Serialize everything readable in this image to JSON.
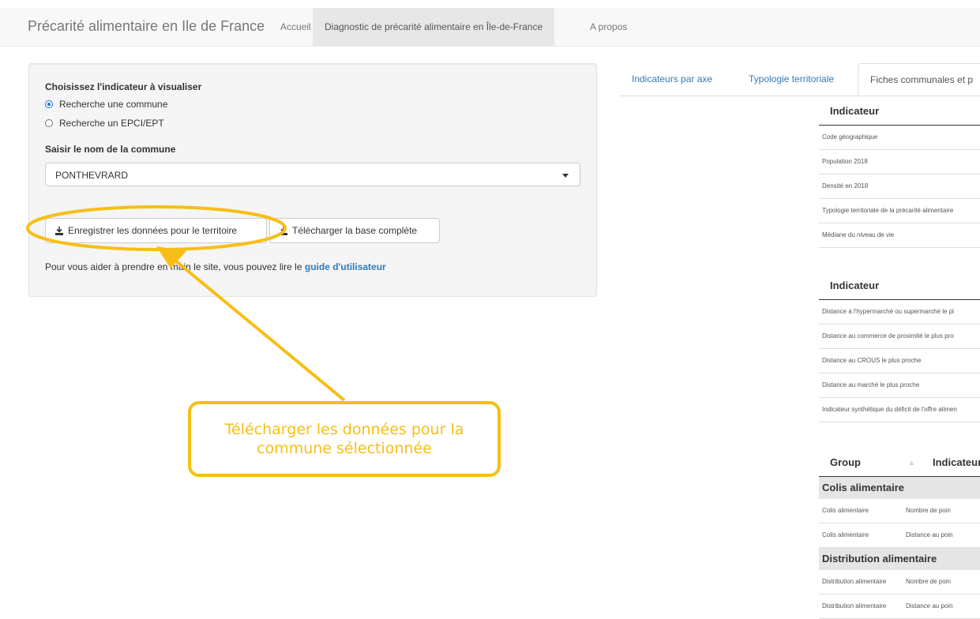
{
  "navbar": {
    "brand": "Précarité alimentaire en Ile de France",
    "items": [
      "Accueil",
      "Diagnostic de précarité alimentaire en Île-de-France",
      "A propos"
    ]
  },
  "sidebar": {
    "indicator_label": "Choisissez l'indicateur à visualiser",
    "radio_commune": "Recherche une commune",
    "radio_epci": "Recherche un EPCI/EPT",
    "commune_label": "Saisir le nom de la commune",
    "commune_value": "PONTHEVRARD",
    "btn_save": "Enregistrer les données pour le territoire",
    "btn_download": "Télécharger la base complète",
    "help_text": "Pour vous aider à prendre en main le site, vous pouvez lire le ",
    "help_link": "guide d'utilisateur"
  },
  "tabs": [
    "Indicateurs par axe",
    "Typologie territoriale",
    "Fiches communales et p"
  ],
  "table1": {
    "header": "Indicateur",
    "rows": [
      "Code géographique",
      "Population 2018",
      "Densité en 2018",
      "Typologie territoriale de la précarité alimentaire",
      "Médiane du niveau de vie"
    ]
  },
  "table2": {
    "header": "Indicateur",
    "rows": [
      "Distance à l'hypermarché ou supermarché le pl",
      "Distance au commerce de proximité le plus pro",
      "Distance au CROUS le plus proche",
      "Distance au marché le plus proche",
      "Indicateur synthétique du déficit de l'offre alimen"
    ]
  },
  "table3": {
    "header_group": "Group",
    "header_ind": "Indicateur",
    "groups": [
      {
        "name": "Colis alimentaire",
        "rows": [
          [
            "Colis alimentaire",
            "Nombre de poin"
          ],
          [
            "Colis alimentaire",
            "Distance au poin"
          ]
        ]
      },
      {
        "name": "Distribution alimentaire",
        "rows": [
          [
            "Distribution alimentaire",
            "Nombre de poin"
          ],
          [
            "Distribution alimentaire",
            "Distance au poin"
          ]
        ]
      }
    ]
  },
  "annotation": {
    "text": "Télécharger les données pour la commune sélectionnée",
    "color": "#f7be16"
  }
}
